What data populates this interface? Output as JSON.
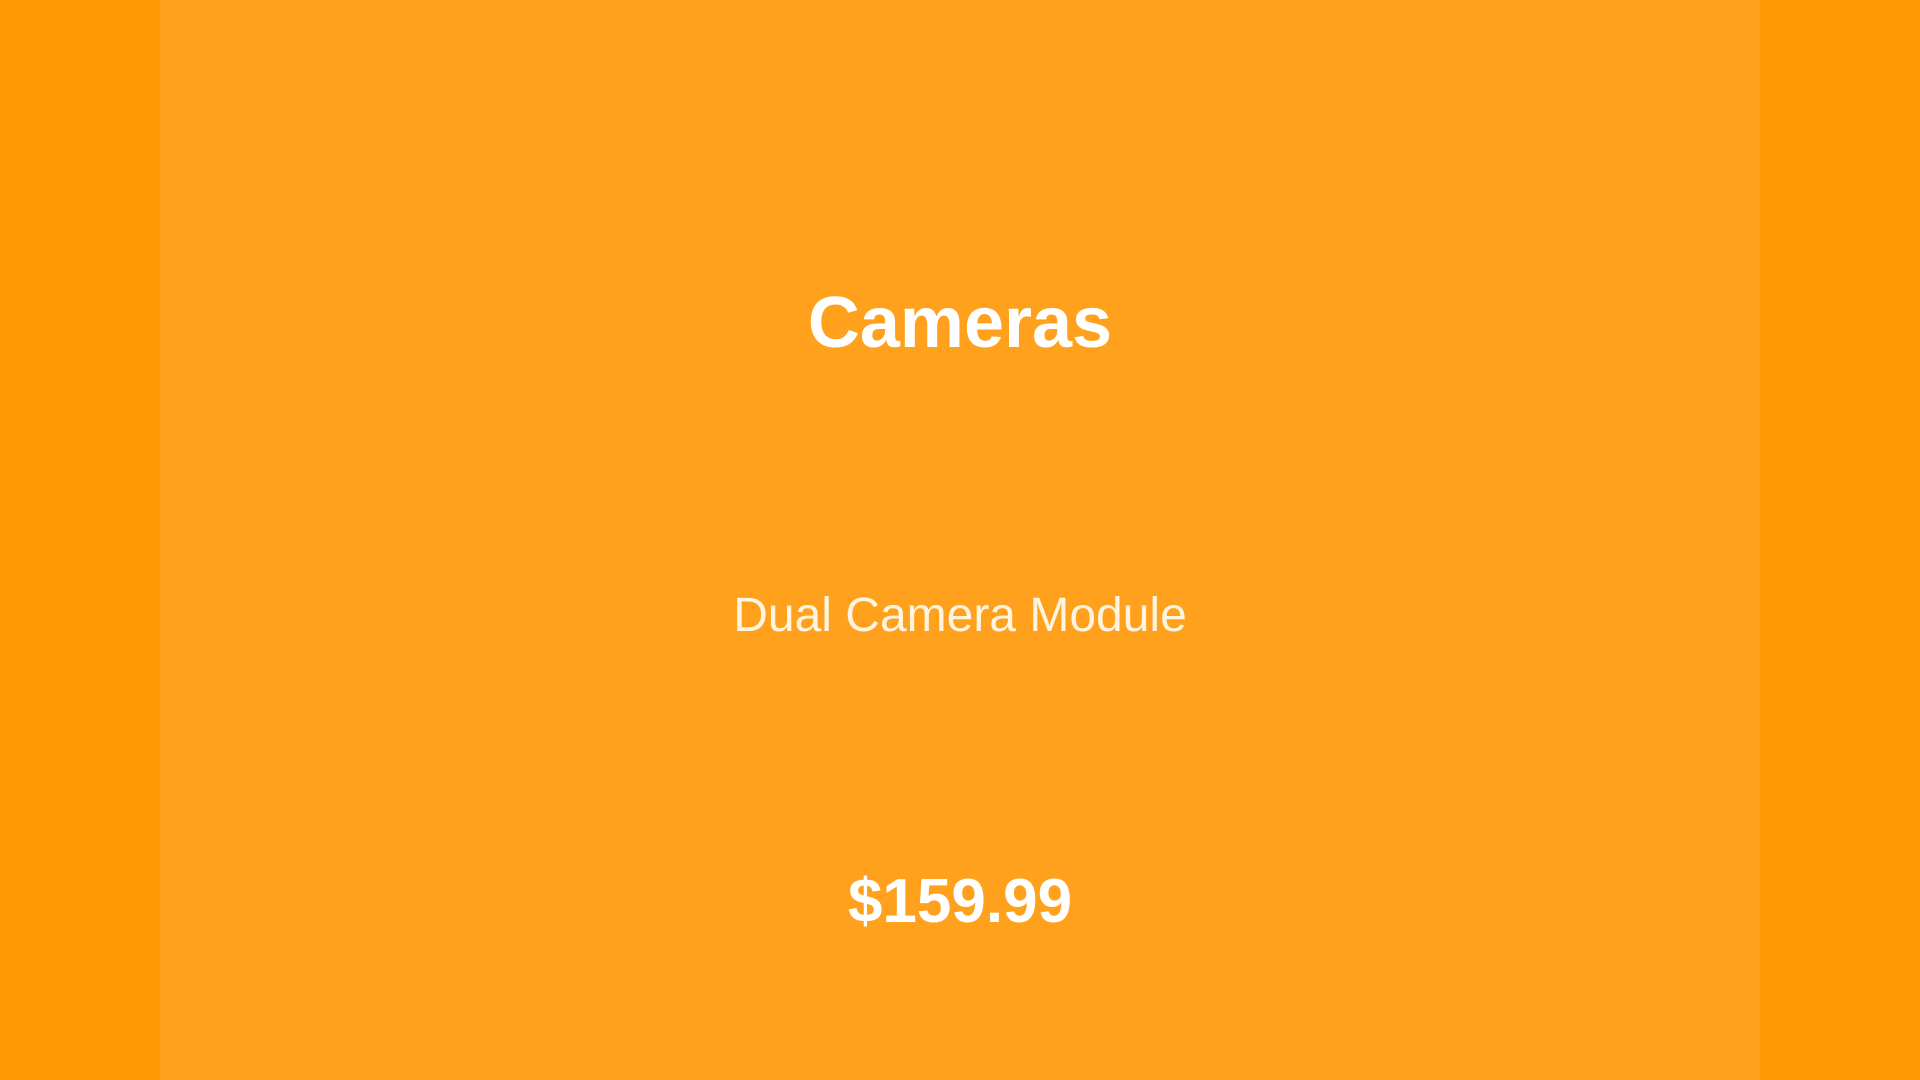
{
  "product_card": {
    "category": "Cameras",
    "name": "Dual Camera Module",
    "price": "$159.99"
  },
  "colors": {
    "outer_background": "#FF9804",
    "card_background": "#FFA11C",
    "text_primary": "#FFFFFF",
    "text_secondary": "#FFF4E0"
  }
}
